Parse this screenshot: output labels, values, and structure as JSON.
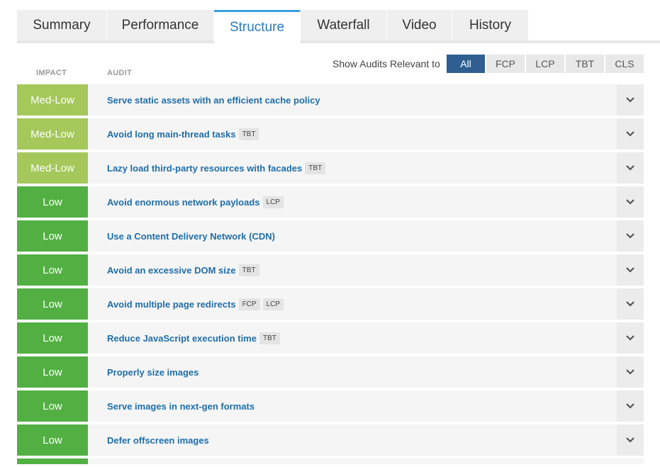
{
  "tabs": [
    {
      "label": "Summary"
    },
    {
      "label": "Performance"
    },
    {
      "label": "Structure",
      "active": true
    },
    {
      "label": "Waterfall"
    },
    {
      "label": "Video"
    },
    {
      "label": "History"
    }
  ],
  "headers": {
    "impact": "IMPACT",
    "audit": "AUDIT"
  },
  "filter": {
    "label": "Show Audits Relevant to",
    "options": [
      "All",
      "FCP",
      "LCP",
      "TBT",
      "CLS"
    ],
    "selected": "All"
  },
  "colors": {
    "med_low": "#a5c85a",
    "low": "#52b043",
    "accent": "#2f5f91",
    "link": "#1f6ea8"
  },
  "audits": [
    {
      "impact": "Med-Low",
      "title": "Serve static assets with an efficient cache policy",
      "tags": []
    },
    {
      "impact": "Med-Low",
      "title": "Avoid long main-thread tasks",
      "tags": [
        "TBT"
      ]
    },
    {
      "impact": "Med-Low",
      "title": "Lazy load third-party resources with facades",
      "tags": [
        "TBT"
      ]
    },
    {
      "impact": "Low",
      "title": "Avoid enormous network payloads",
      "tags": [
        "LCP"
      ]
    },
    {
      "impact": "Low",
      "title": "Use a Content Delivery Network (CDN)",
      "tags": []
    },
    {
      "impact": "Low",
      "title": "Avoid an excessive DOM size",
      "tags": [
        "TBT"
      ]
    },
    {
      "impact": "Low",
      "title": "Avoid multiple page redirects",
      "tags": [
        "FCP",
        "LCP"
      ]
    },
    {
      "impact": "Low",
      "title": "Reduce JavaScript execution time",
      "tags": [
        "TBT"
      ]
    },
    {
      "impact": "Low",
      "title": "Properly size images",
      "tags": []
    },
    {
      "impact": "Low",
      "title": "Serve images in next-gen formats",
      "tags": []
    },
    {
      "impact": "Low",
      "title": "Defer offscreen images",
      "tags": []
    }
  ]
}
